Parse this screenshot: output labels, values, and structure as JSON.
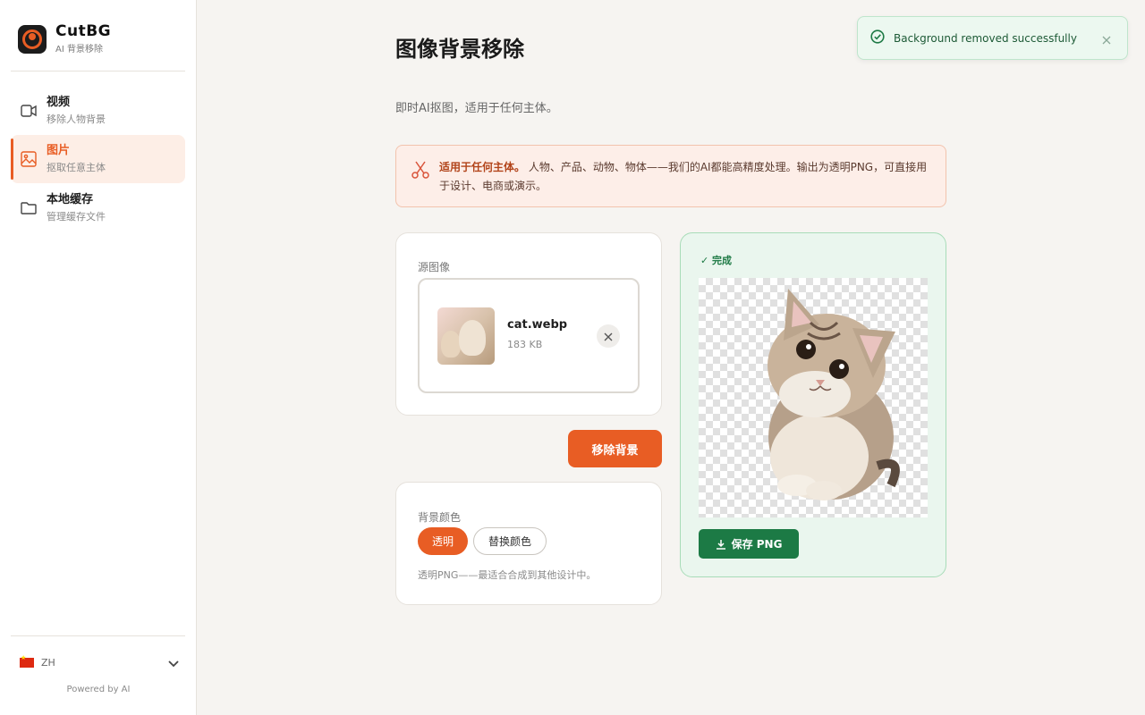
{
  "brand": {
    "name": "CutBG",
    "subtitle": "AI 背景移除"
  },
  "sidebar": {
    "items": [
      {
        "title": "视频",
        "subtitle": "移除人物背景",
        "icon": "video-icon"
      },
      {
        "title": "图片",
        "subtitle": "抠取任意主体",
        "icon": "image-icon",
        "active": true
      },
      {
        "title": "本地缓存",
        "subtitle": "管理缓存文件",
        "icon": "folder-icon"
      }
    ],
    "language": "ZH",
    "powered_by": "Powered by AI"
  },
  "main": {
    "title": "图像背景移除",
    "subtitle": "即时AI抠图，适用于任何主体。",
    "info": {
      "bold": "适用于任何主体。",
      "text": "人物、产品、动物、物体——我们的AI都能高精度处理。输出为透明PNG，可直接用于设计、电商或演示。"
    },
    "source": {
      "label": "源图像",
      "file_name": "cat.webp",
      "file_size": "183 KB"
    },
    "remove_button": "移除背景",
    "background": {
      "label": "背景颜色",
      "options": [
        "透明",
        "替换颜色"
      ],
      "selected": "透明",
      "hint": "透明PNG——最适合合成到其他设计中。"
    },
    "result": {
      "status": "✓ 完成",
      "save_button": "保存 PNG"
    }
  },
  "toast": {
    "message": "Background removed successfully"
  },
  "colors": {
    "accent": "#e85d24",
    "success": "#1c7a45",
    "info_bg": "#fdeee8"
  }
}
